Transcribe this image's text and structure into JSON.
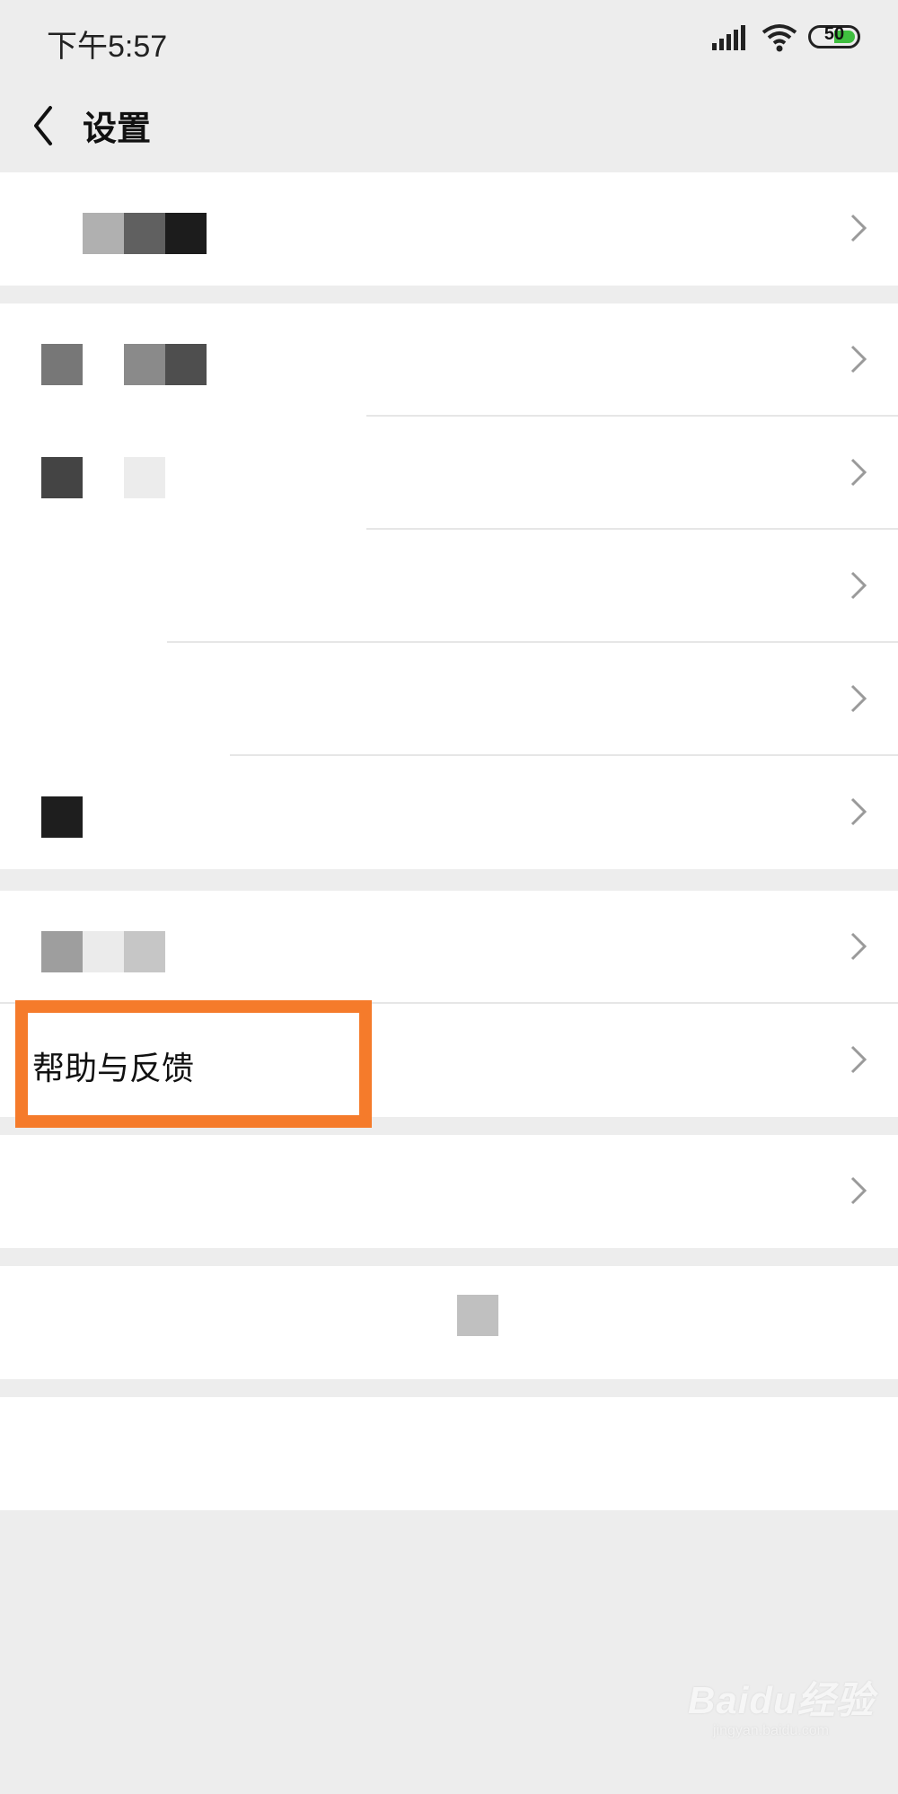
{
  "status_bar": {
    "time": "下午5:57",
    "battery_level": "50",
    "battery_color": "#3fbf3f"
  },
  "nav": {
    "title": "设置",
    "back_icon": "chevron-left-icon"
  },
  "settings": {
    "help_feedback_label": "帮助与反馈"
  },
  "highlight_color": "#f57b2b",
  "watermark": {
    "main": "Baidu经验",
    "sub": "jingyan.baidu.com"
  }
}
